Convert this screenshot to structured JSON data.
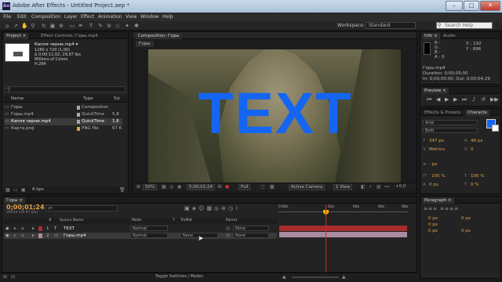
{
  "window": {
    "title": "Adobe After Effects - Untitled Project.aep *",
    "app_icon": "Ae",
    "minimize": "–",
    "maximize": "□",
    "close": "✕"
  },
  "menu": [
    "File",
    "Edit",
    "Composition",
    "Layer",
    "Effect",
    "Animation",
    "View",
    "Window",
    "Help"
  ],
  "toolbar": {
    "workspace_label": "Workspace:",
    "workspace_value": "Standard",
    "search_placeholder": "Search Help"
  },
  "project_panel": {
    "tabs": [
      "Project ×",
      "Effect Controls: Горы.mp4"
    ],
    "selected_item": "Капля черни.mp4 ▾",
    "info_lines": [
      "1280 x 720 (1,00)",
      "Δ 0;00;11;02, 29,97 fps",
      "Millions of Colors",
      "H.264"
    ],
    "search_icon": "search-icon",
    "columns": {
      "name": "Name",
      "type": "Type",
      "size": "Siz"
    },
    "items": [
      {
        "name": "Горы",
        "type": "Composition",
        "size": "",
        "color": "#a8a8a8"
      },
      {
        "name": "Горы.mp4",
        "type": "QuickTime",
        "size": "5,8 M",
        "color": "#a8a8a8"
      },
      {
        "name": "Капля черни.mp4",
        "type": "QuickTime",
        "size": "1,6",
        "color": "#a8a8a8"
      },
      {
        "name": "Карта.png",
        "type": "PNG file",
        "size": "67 K",
        "color": "#d7a64b"
      }
    ],
    "bpc": "8 bpc"
  },
  "composition_panel": {
    "tab": "Composition: Горы",
    "breadcrumb": "Горы",
    "overlay_text": "TEXT",
    "overlay_color": "#1565f2",
    "zoom": "50%",
    "timecode": "0;00;01;24",
    "resolution": "Full",
    "camera": "Active Camera",
    "views": "1 View",
    "exposure": "+0,0"
  },
  "info_panel": {
    "tabs": [
      "Info ×",
      "Audio"
    ],
    "r": "R :",
    "g": "G :",
    "b": "B :",
    "a": "A : 0",
    "x": "X : 192",
    "y": "Y : 896",
    "clip_name": "Горы.mp4",
    "duration": "Duration: 0;00;05;00",
    "in_out": "In: 0;00;00;00, Out: 0;00;04;29"
  },
  "preview_panel": {
    "tab": "Preview ×"
  },
  "effects_panel": {
    "tabs": [
      "Effects & Presets",
      "Characte"
    ]
  },
  "character_panel": {
    "font": "Arial",
    "style": "Bold",
    "size": "347 px",
    "leading": "48 px",
    "kerning": "Metrics",
    "tracking": "0",
    "px": "- px",
    "vscale": "100 %",
    "hscale": "100 %",
    "baseline": "0 px",
    "tsume": "0 %",
    "fill_color": "#1565f2",
    "stroke_color": "#000000"
  },
  "paragraph_panel": {
    "tab": "Paragraph ×",
    "fields": [
      "0 px",
      "0 px",
      "0 px",
      "0 px",
      "0 px"
    ]
  },
  "timeline": {
    "tab": "Горы ×",
    "timecode": "0;00;01;24",
    "frame_info": "00054 (29.97 fps)",
    "search_placeholder": "ρ▾",
    "columns": {
      "num": "#",
      "source": "Source Name",
      "mode": "Mode",
      "t": "T",
      "trkmat": "TrkMat",
      "parent": "Parent"
    },
    "ruler": [
      "0:00s",
      "02s",
      "04s",
      "06s",
      "08s"
    ],
    "layers": [
      {
        "num": "1",
        "name": "TEXT",
        "mode": "Normal",
        "trkmat": "",
        "parent": "None",
        "color": "#a92c2c"
      },
      {
        "num": "2",
        "name": "Горы.mp4",
        "mode": "Normal",
        "trkmat": "None",
        "parent": "None",
        "color": "#a98aa0"
      }
    ],
    "toggle_label": "Toggle Switches / Modes"
  }
}
